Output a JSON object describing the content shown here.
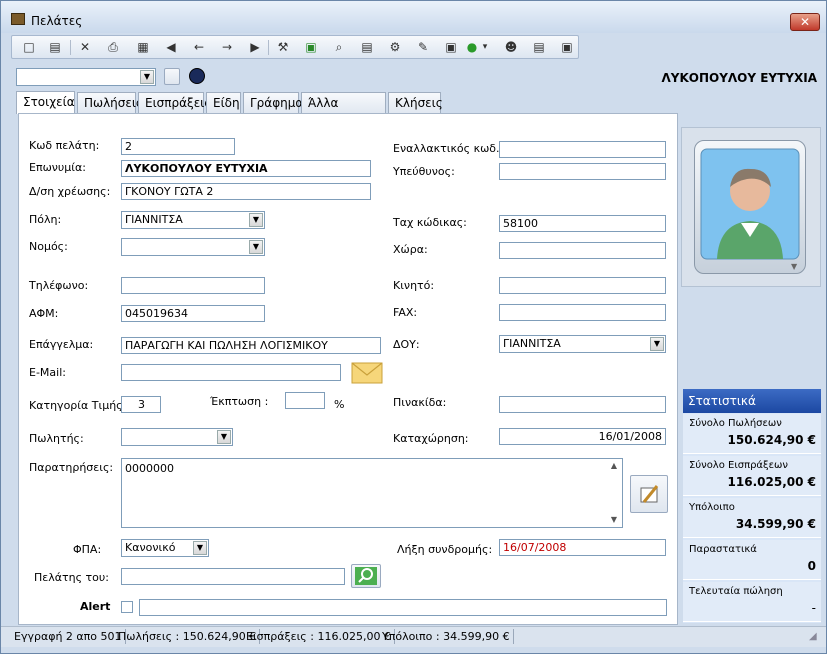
{
  "window": {
    "title": "Πελάτες",
    "close": "✕"
  },
  "toolbar": {
    "icons": [
      "□",
      "▤",
      "✕",
      "⎙",
      "▦",
      "◀",
      "←",
      "→",
      "▶",
      "⚒",
      "▣",
      "⌕",
      "▤",
      "⚙",
      "✎",
      "▣",
      "●",
      "▾",
      "☻",
      "▤",
      "▣"
    ]
  },
  "header": {
    "customer_name": "ΛΥΚΟΠΟΥΛΟΥ ΕΥΤΥΧΙΑ"
  },
  "tabs": [
    "Στοιχεία",
    "Πωλήσεις",
    "Εισπράξεις",
    "Είδη",
    "Γράφημα",
    "Άλλα στοιχεία",
    "Κλήσεις"
  ],
  "form": {
    "code_label": "Κωδ πελάτη:",
    "code_value": "2",
    "name_label": "Επωνυμία:",
    "name_value": "ΛΥΚΟΠΟΥΛΟΥ ΕΥΤΥΧΙΑ",
    "address_label": "Δ/ση χρέωσης:",
    "address_value": "ΓΚΟΝΟΥ ΓΩΤΑ 2",
    "city_label": "Πόλη:",
    "city_value": "ΓΙΑΝΝΙΤΣΑ",
    "prefecture_label": "Νομός:",
    "prefecture_value": "",
    "phone_label": "Τηλέφωνο:",
    "phone_value": "",
    "afm_label": "ΑΦΜ:",
    "afm_value": "045019634",
    "profession_label": "Επάγγελμα:",
    "profession_value": "ΠΑΡΑΓΩΓΗ ΚΑΙ ΠΩΛΗΣΗ ΛΟΓΙΣΜΙΚΟΥ",
    "email_label": "E-Mail:",
    "email_value": "",
    "price_cat_label": "Κατηγορία Τιμής:",
    "price_cat_value": "3",
    "discount_label": "Έκπτωση :",
    "discount_value": "",
    "discount_unit": "%",
    "salesman_label": "Πωλητής:",
    "salesman_value": "",
    "notes_label": "Παρατηρήσεις:",
    "notes_value": "0000000",
    "vat_label": "ΦΠΑ:",
    "vat_value": "Κανονικό",
    "customer_of_label": "Πελάτης του:",
    "customer_of_value": "",
    "alert_label": "Alert",
    "alert_value": "",
    "alt_code_label": "Εναλλακτικός κωδ.:",
    "alt_code_value": "",
    "responsible_label": "Υπεύθυνος:",
    "responsible_value": "",
    "postal_label": "Ταχ κώδικας:",
    "postal_value": "58100",
    "country_label": "Χώρα:",
    "country_value": "",
    "mobile_label": "Κινητό:",
    "mobile_value": "",
    "fax_label": "FAX:",
    "fax_value": "",
    "doy_label": "ΔΟΥ:",
    "doy_value": "ΓΙΑΝΝΙΤΣΑ",
    "plate_label": "Πινακίδα:",
    "plate_value": "",
    "registration_label": "Καταχώρηση:",
    "registration_value": "16/01/2008",
    "expiry_label": "Λήξη συνδρομής:",
    "expiry_value": "16/07/2008"
  },
  "stats": {
    "title": "Στατιστικά",
    "items": [
      {
        "label": "Σύνολο Πωλήσεων",
        "value": "150.624,90 €"
      },
      {
        "label": "Σύνολο Εισπράξεων",
        "value": "116.025,00 €"
      },
      {
        "label": "Υπόλοιπο",
        "value": "34.599,90 €"
      },
      {
        "label": "Παραστατικά",
        "value": "0"
      },
      {
        "label": "Τελευταία πώληση",
        "value": "-"
      }
    ]
  },
  "status": {
    "record": "Εγγραφή 2 απο 501",
    "sales": "Πωλήσεις : 150.624,90 €",
    "receipts": "Εισπράξεις : 116.025,00 €",
    "balance": "Υπόλοιπο : 34.599,90 €"
  },
  "colors": {
    "accent": "#1c48a2",
    "expiry": "#c00000"
  }
}
